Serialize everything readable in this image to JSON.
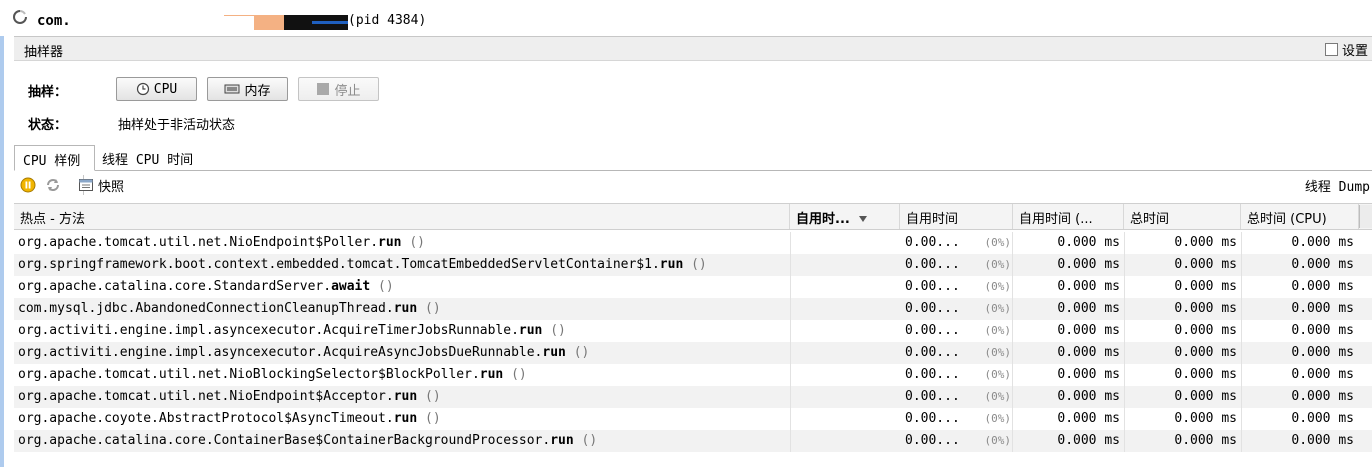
{
  "title": {
    "app_name": "com.",
    "pid": "(pid 4384)"
  },
  "sampler": {
    "header": "抽样器",
    "settings_label": "设置",
    "sample_label": "抽样：",
    "cpu_button": "CPU",
    "memory_button": "内存",
    "stop_button": "停止",
    "status_label": "状态：",
    "status_value": "抽样处于非活动状态"
  },
  "tabs": [
    "CPU 样例",
    "线程 CPU 时间"
  ],
  "toolbar": {
    "snapshot": "快照",
    "thread_dump": "线程 Dump"
  },
  "table": {
    "columns": [
      "热点 - 方法",
      "自用时...",
      "自用时间",
      "自用时间 (...",
      "总时间",
      "总时间 (CPU)"
    ],
    "rows": [
      {
        "prefix": "org.apache.tomcat.util.net.NioEndpoint$Poller.",
        "method": "run",
        "args": "()",
        "self_time": "0.00...",
        "pct": "(0%)",
        "self_cpu": "0.000 ms",
        "total": "0.000 ms",
        "total_cpu": "0.000 ms"
      },
      {
        "prefix": "org.springframework.boot.context.embedded.tomcat.TomcatEmbeddedServletContainer$1.",
        "method": "run",
        "args": "()",
        "self_time": "0.00...",
        "pct": "(0%)",
        "self_cpu": "0.000 ms",
        "total": "0.000 ms",
        "total_cpu": "0.000 ms"
      },
      {
        "prefix": "org.apache.catalina.core.StandardServer.",
        "method": "await",
        "args": "()",
        "self_time": "0.00...",
        "pct": "(0%)",
        "self_cpu": "0.000 ms",
        "total": "0.000 ms",
        "total_cpu": "0.000 ms"
      },
      {
        "prefix": "com.mysql.jdbc.AbandonedConnectionCleanupThread.",
        "method": "run",
        "args": "()",
        "self_time": "0.00...",
        "pct": "(0%)",
        "self_cpu": "0.000 ms",
        "total": "0.000 ms",
        "total_cpu": "0.000 ms"
      },
      {
        "prefix": "org.activiti.engine.impl.asyncexecutor.AcquireTimerJobsRunnable.",
        "method": "run",
        "args": "()",
        "self_time": "0.00...",
        "pct": "(0%)",
        "self_cpu": "0.000 ms",
        "total": "0.000 ms",
        "total_cpu": "0.000 ms"
      },
      {
        "prefix": "org.activiti.engine.impl.asyncexecutor.AcquireAsyncJobsDueRunnable.",
        "method": "run",
        "args": "()",
        "self_time": "0.00...",
        "pct": "(0%)",
        "self_cpu": "0.000 ms",
        "total": "0.000 ms",
        "total_cpu": "0.000 ms"
      },
      {
        "prefix": "org.apache.tomcat.util.net.NioBlockingSelector$BlockPoller.",
        "method": "run",
        "args": "()",
        "self_time": "0.00...",
        "pct": "(0%)",
        "self_cpu": "0.000 ms",
        "total": "0.000 ms",
        "total_cpu": "0.000 ms"
      },
      {
        "prefix": "org.apache.tomcat.util.net.NioEndpoint$Acceptor.",
        "method": "run",
        "args": "()",
        "self_time": "0.00...",
        "pct": "(0%)",
        "self_cpu": "0.000 ms",
        "total": "0.000 ms",
        "total_cpu": "0.000 ms"
      },
      {
        "prefix": "org.apache.coyote.AbstractProtocol$AsyncTimeout.",
        "method": "run",
        "args": "()",
        "self_time": "0.00...",
        "pct": "(0%)",
        "self_cpu": "0.000 ms",
        "total": "0.000 ms",
        "total_cpu": "0.000 ms"
      },
      {
        "prefix": "org.apache.catalina.core.ContainerBase$ContainerBackgroundProcessor.",
        "method": "run",
        "args": "()",
        "self_time": "0.00...",
        "pct": "(0%)",
        "self_cpu": "0.000 ms",
        "total": "0.000 ms",
        "total_cpu": "0.000 ms"
      }
    ]
  },
  "colors": {
    "accent_blue": "#1f5fbf",
    "redact_orange": "#f4b183",
    "redact_black": "#111111"
  }
}
